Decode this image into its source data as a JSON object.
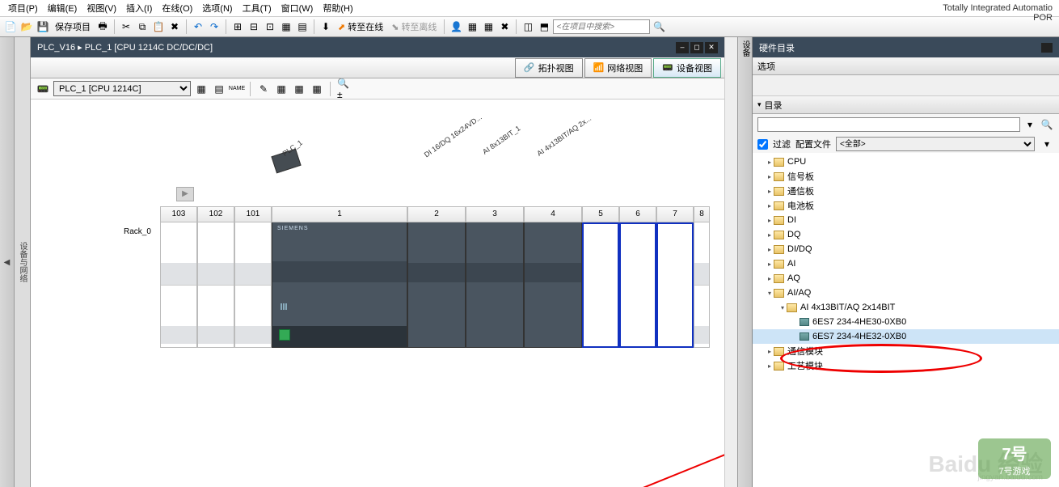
{
  "brand": "Totally Integrated Automatio",
  "brand2": "POR",
  "menu": {
    "project": "项目(P)",
    "edit": "编辑(E)",
    "view": "视图(V)",
    "insert": "插入(I)",
    "online": "在线(O)",
    "options": "选项(N)",
    "tools": "工具(T)",
    "window": "窗口(W)",
    "help": "帮助(H)"
  },
  "toolbar": {
    "save": "保存项目",
    "go_online": "转至在线",
    "go_offline": "转至离线",
    "search_ph": "<在项目中搜索>"
  },
  "left_strip": "设备与网络",
  "titlebar": {
    "path": "PLC_V16  ▸  PLC_1 [CPU 1214C DC/DC/DC]"
  },
  "viewtabs": {
    "topo": "拓扑视图",
    "net": "网络视图",
    "dev": "设备视图"
  },
  "device_selector": "PLC_1 [CPU 1214C]",
  "right_strip": "设备",
  "canvas": {
    "rack": "Rack_0",
    "plc_label": "PLC_1",
    "mod_labels": {
      "di": "DI 16/DQ 16x24VD...",
      "ai": "AI 8x13BIT_1",
      "aiaq": "AI 4x13BIT/AQ 2x..."
    },
    "slots": [
      "103",
      "102",
      "101",
      "1",
      "2",
      "3",
      "4",
      "5",
      "6",
      "7",
      "8"
    ],
    "siemens": "SIEMENS"
  },
  "catalog": {
    "header": "硬件目录",
    "options": "选项",
    "tree_hdr": "目录",
    "filter_lbl": "过滤",
    "profile_lbl": "配置文件",
    "profile_val": "<全部>",
    "items": {
      "cpu": "CPU",
      "sig": "信号板",
      "comm": "通信板",
      "bat": "电池板",
      "di": "DI",
      "dq": "DQ",
      "didq": "DI/DQ",
      "ai": "AI",
      "aq": "AQ",
      "aiaq": "AI/AQ",
      "aiaq_sub": "AI 4x13BIT/AQ 2x14BIT",
      "p1": "6ES7 234-4HE30-0XB0",
      "p2": "6ES7 234-4HE32-0XB0",
      "commmod": "通信模块",
      "tech": "工艺模块"
    }
  },
  "watermark": {
    "baidu": "Baidu 经验",
    "url": "jingyan.baidu.com",
    "game": "7号游戏"
  }
}
